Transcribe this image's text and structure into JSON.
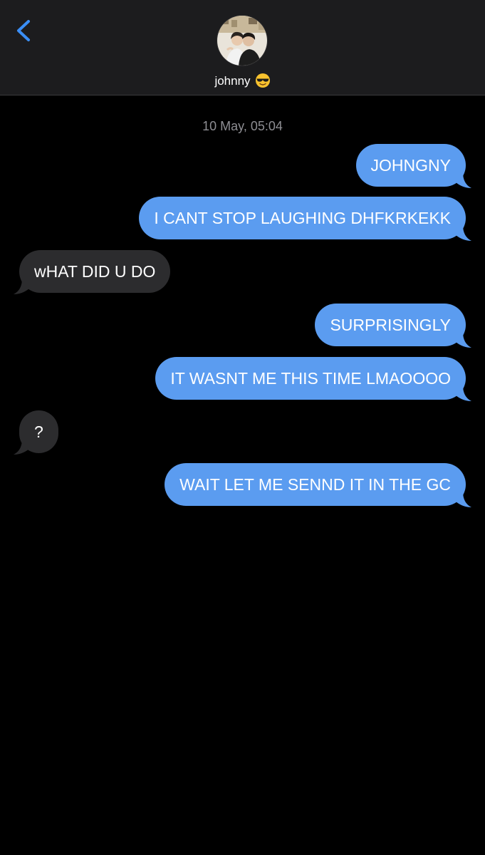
{
  "header": {
    "back_icon": "chevron-left-icon",
    "contact_name": "johnny",
    "contact_emoji": "😎",
    "avatar_icon": "contact-avatar-photo"
  },
  "conversation": {
    "timestamp": "10 May, 05:04",
    "messages": [
      {
        "from": "me",
        "text": "JOHNGNY"
      },
      {
        "from": "me",
        "text": "I CANT STOP LAUGHING DHFKRKEKK"
      },
      {
        "from": "them",
        "text": "wHAT DID U DO"
      },
      {
        "from": "me",
        "text": "SURPRISINGLY"
      },
      {
        "from": "me",
        "text": "IT WASNT ME THIS TIME LMAOOOO"
      },
      {
        "from": "them",
        "text": "?"
      },
      {
        "from": "me",
        "text": "WAIT LET ME SENND IT IN THE GC"
      }
    ]
  },
  "colors": {
    "sent_bubble": "#5b9cf0",
    "received_bubble": "#2c2c2e",
    "header_background": "#1c1c1e",
    "accent_blue": "#3a8ef6",
    "timestamp_gray": "#8e8e93"
  }
}
